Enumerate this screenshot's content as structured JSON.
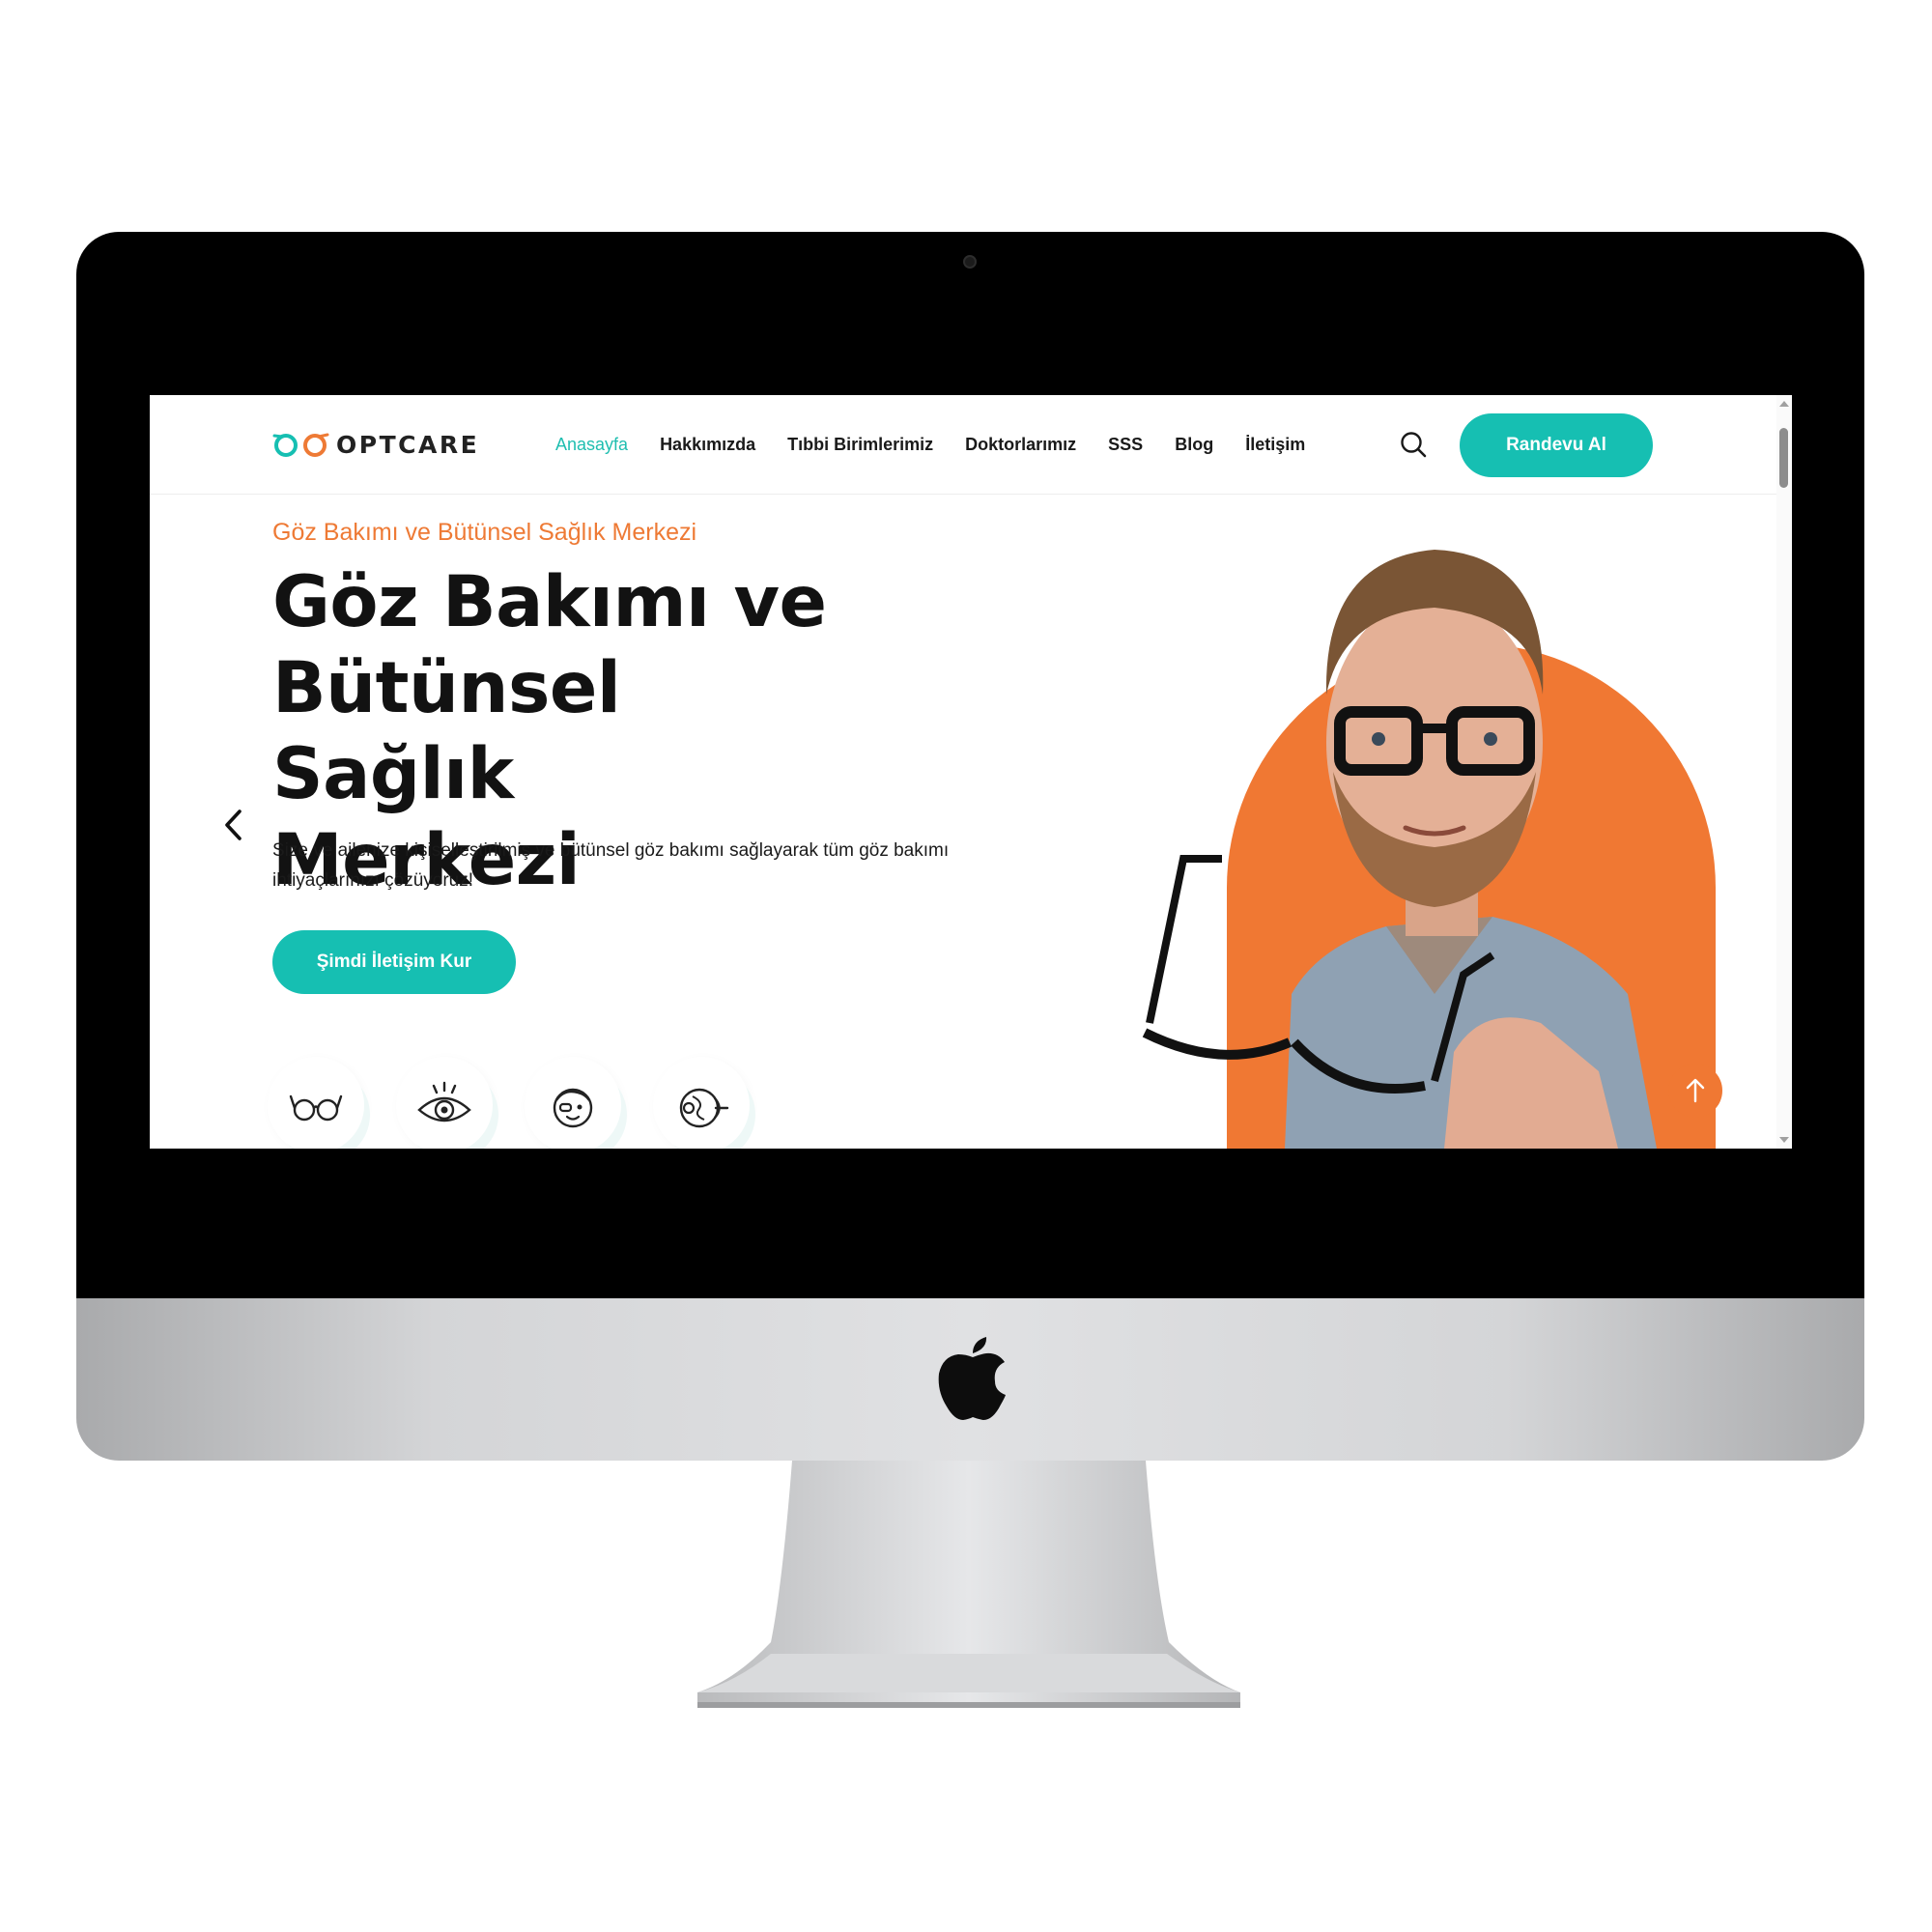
{
  "brand": {
    "name": "OPTCARE",
    "teal": "#16bfb2",
    "orange": "#ee7a35"
  },
  "nav": {
    "items": [
      {
        "label": "Anasayfa",
        "active": true
      },
      {
        "label": "Hakkımızda"
      },
      {
        "label": "Tıbbi Birimlerimiz"
      },
      {
        "label": "Doktorlarımız"
      },
      {
        "label": "SSS"
      },
      {
        "label": "Blog"
      },
      {
        "label": "İletişim"
      }
    ],
    "search_icon": "search-icon",
    "cta_label": "Randevu Al"
  },
  "hero": {
    "eyebrow": "Göz Bakımı ve Bütünsel Sağlık Merkezi",
    "title_lines": [
      "Göz Bakımı ve",
      "Bütünsel Sağlık",
      "Merkezi"
    ],
    "description": "Size ve ailenize kişiselleştirilmiş ve bütünsel göz bakımı sağlayarak tüm göz bakımı ihtiyaçlarınızı çözüyoruz!",
    "cta_label": "Şimdi İletişim Kur",
    "prev_icon": "chevron-left-icon",
    "next_icon": "chevron-right-icon"
  },
  "features": [
    {
      "icon": "eyeglasses-icon"
    },
    {
      "icon": "eye-icon"
    },
    {
      "icon": "child-face-icon"
    },
    {
      "icon": "eyeball-anatomy-icon"
    }
  ],
  "scroll_top_icon": "arrow-up-icon",
  "device_logo": "apple-logo-icon"
}
